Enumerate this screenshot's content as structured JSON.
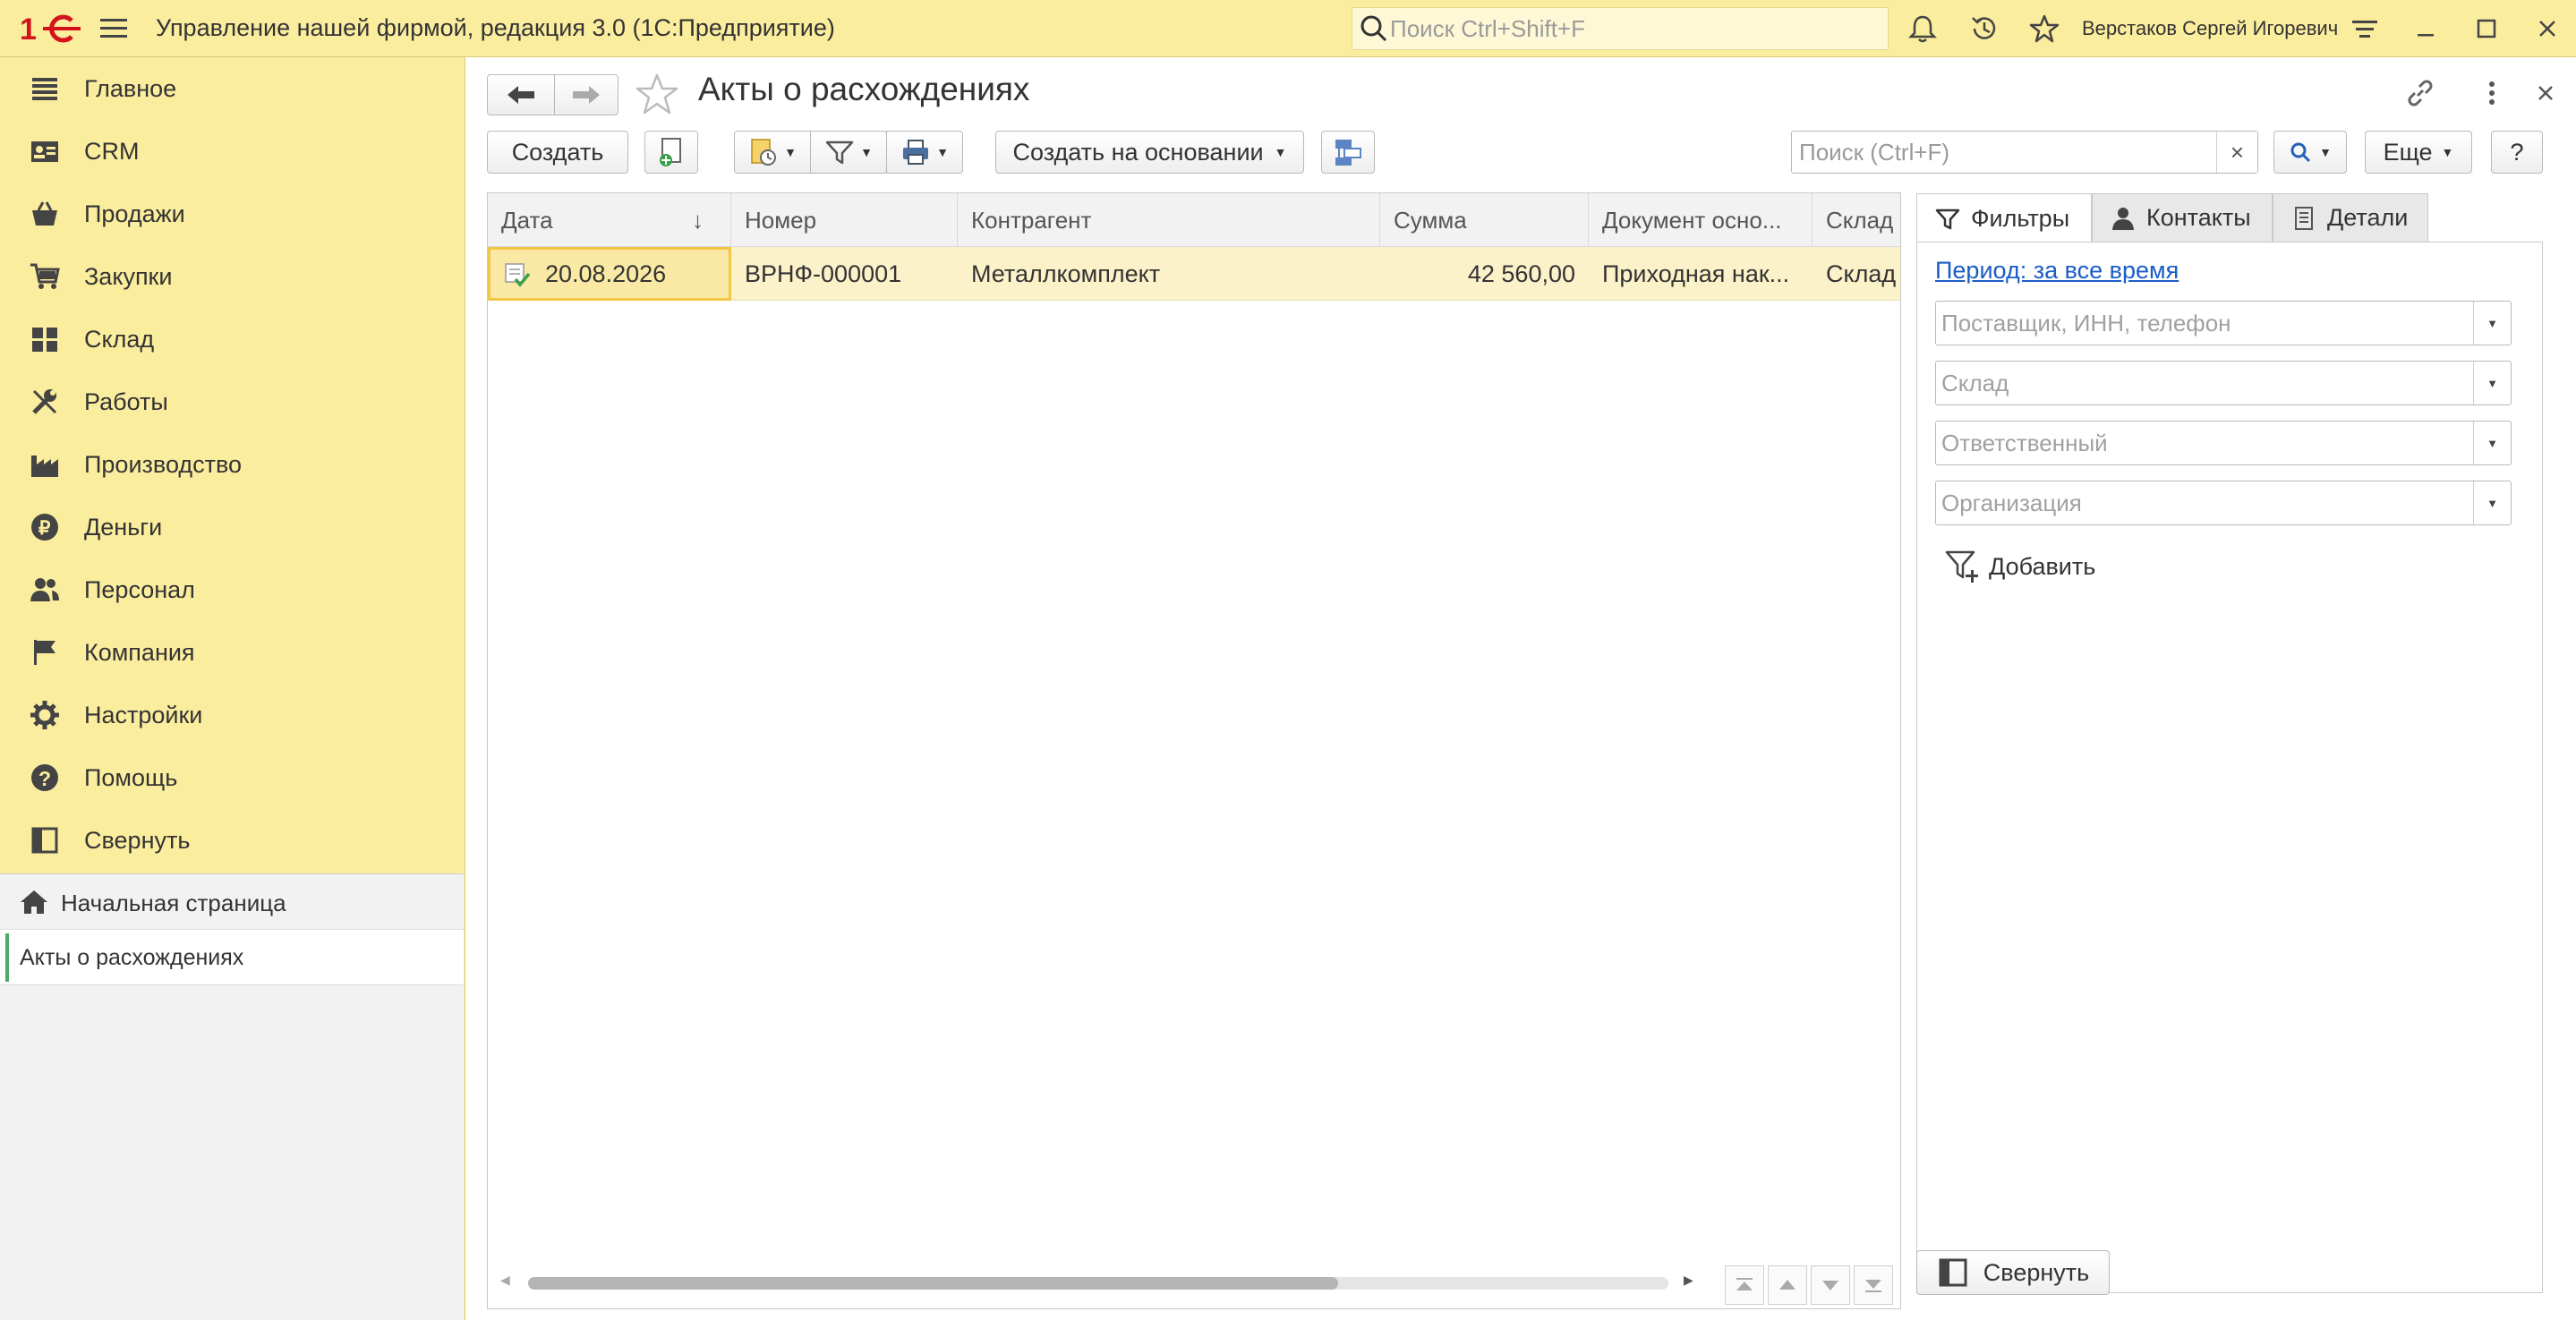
{
  "app": {
    "title": "Управление нашей фирмой, редакция 3.0  (1С:Предприятие)",
    "search_placeholder": "Поиск Ctrl+Shift+F",
    "user_name": "Верстаков Сергей Игоревич",
    "icons": [
      "1c-logo-icon",
      "menu-icon",
      "search-icon",
      "bell-icon",
      "history-icon",
      "star-icon",
      "settings-lines-icon",
      "minimize-icon",
      "maximize-icon",
      "close-icon"
    ]
  },
  "sidebar": {
    "items": [
      {
        "label": "Главное",
        "icon": "menu-lines-icon"
      },
      {
        "label": "CRM",
        "icon": "crm-card-icon"
      },
      {
        "label": "Продажи",
        "icon": "basket-icon"
      },
      {
        "label": "Закупки",
        "icon": "cart-icon"
      },
      {
        "label": "Склад",
        "icon": "warehouse-icon"
      },
      {
        "label": "Работы",
        "icon": "tools-icon"
      },
      {
        "label": "Производство",
        "icon": "factory-icon"
      },
      {
        "label": "Деньги",
        "icon": "ruble-icon"
      },
      {
        "label": "Персонал",
        "icon": "people-icon"
      },
      {
        "label": "Компания",
        "icon": "flag-icon"
      },
      {
        "label": "Настройки",
        "icon": "gear-icon"
      },
      {
        "label": "Помощь",
        "icon": "help-icon"
      },
      {
        "label": "Свернуть",
        "icon": "collapse-panel-icon"
      }
    ],
    "open_pages": {
      "home": "Начальная страница",
      "current": "Акты о расхождениях"
    }
  },
  "form": {
    "title": "Акты о расхождениях",
    "toolbar": {
      "create_label": "Создать",
      "create_based_label": "Создать на основании",
      "more_label": "Еще",
      "help_label": "?",
      "search_placeholder": "Поиск (Ctrl+F)",
      "clear_label": "×"
    },
    "table": {
      "columns": [
        "Дата",
        "Номер",
        "Контрагент",
        "Сумма",
        "Документ осно...",
        "Склад"
      ],
      "sort_indicator": "↓",
      "rows": [
        {
          "date": "20.08.2026",
          "number": "ВРНФ-000001",
          "counterparty": "Металлкомплект",
          "amount": "42 560,00",
          "base_document": "Приходная нак...",
          "warehouse": "Склад"
        }
      ],
      "scroll_position": 0.71
    },
    "panel": {
      "tabs": [
        {
          "label": "Фильтры",
          "icon": "filter-icon",
          "active": true
        },
        {
          "label": "Контакты",
          "icon": "person-icon",
          "active": false
        },
        {
          "label": "Детали",
          "icon": "details-icon",
          "active": false
        }
      ],
      "period_link": "Период: за все время",
      "filters": [
        {
          "placeholder": "Поставщик, ИНН, телефон"
        },
        {
          "placeholder": "Склад"
        },
        {
          "placeholder": "Ответственный"
        },
        {
          "placeholder": "Организация"
        }
      ],
      "add_filter_label": "Добавить",
      "collapse_label": "Свернуть"
    }
  },
  "colors": {
    "chrome_yellow": "#fbed9e",
    "row_selected": "#fcf2c9",
    "cell_focus_border": "#f2c744",
    "link_blue": "#1a5cc8",
    "accent_green": "#4fa868",
    "logo_red": "#d3121b"
  }
}
